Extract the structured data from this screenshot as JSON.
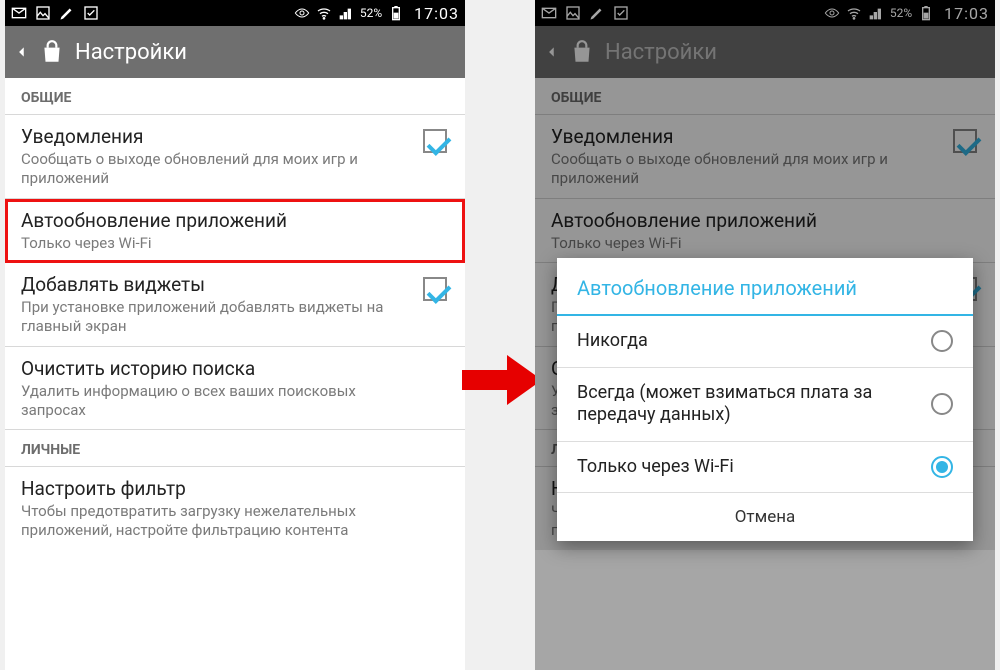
{
  "status": {
    "battery_pct": "52%",
    "time": "17:03"
  },
  "actionbar": {
    "title": "Настройки"
  },
  "sections": {
    "general": "ОБЩИЕ",
    "personal": "ЛИЧНЫЕ"
  },
  "items": {
    "notifications": {
      "title": "Уведомления",
      "sub": "Сообщать о выходе обновлений для моих игр и приложений",
      "checked": true
    },
    "autoupdate": {
      "title": "Автообновление приложений",
      "sub": "Только через Wi-Fi"
    },
    "widgets": {
      "title": "Добавлять виджеты",
      "sub": "При установке приложений добавлять виджеты на главный экран",
      "checked": true
    },
    "clear_search": {
      "title": "Очистить историю поиска",
      "sub": "Удалить информацию о всех ваших поисковых запросах"
    },
    "filter": {
      "title": "Настроить фильтр",
      "sub": "Чтобы предотвратить загрузку нежелательных приложений, настройте фильтрацию контента"
    }
  },
  "dialog": {
    "title": "Автообновление приложений",
    "options": {
      "never": "Никогда",
      "always": "Всегда (может взиматься плата за передачу данных)",
      "wifi": "Только через Wi-Fi"
    },
    "selected": "wifi",
    "cancel": "Отмена"
  }
}
